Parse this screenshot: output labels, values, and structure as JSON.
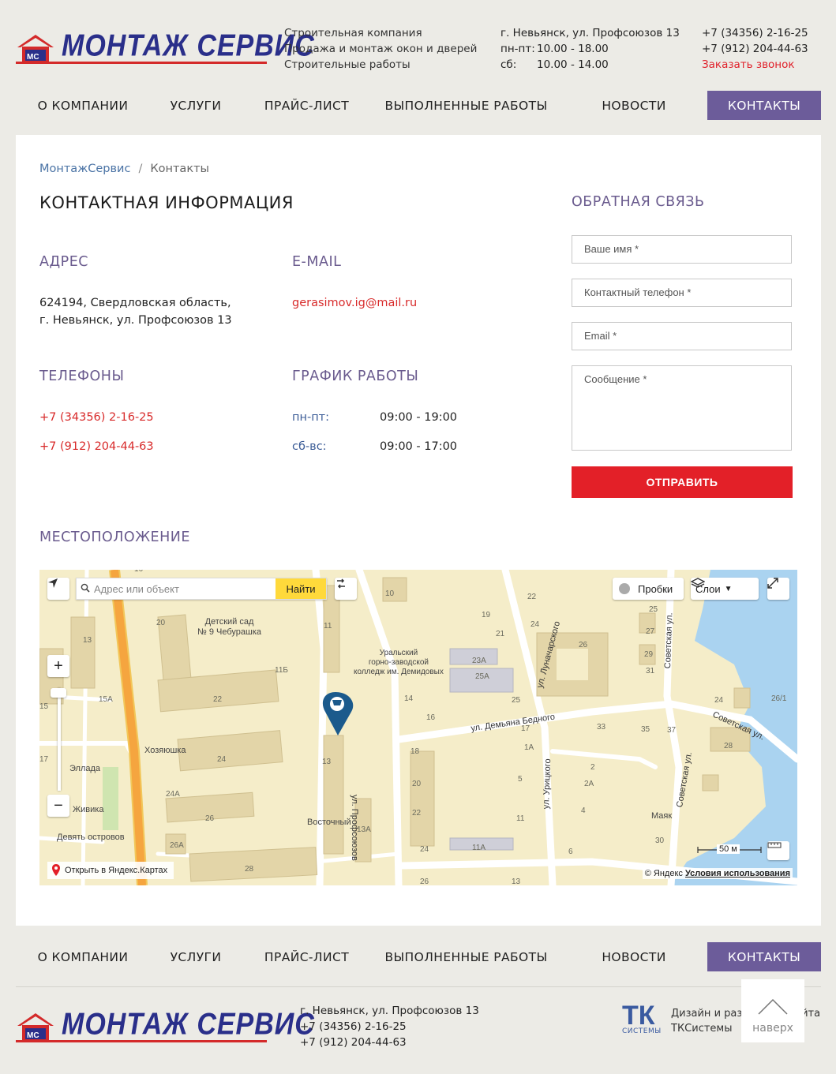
{
  "header": {
    "brand": "МОНТАЖ СЕРВИС",
    "badge": "МС",
    "desc": [
      "Строительная компания",
      "Продажа и монтаж окон и дверей",
      "Строительные работы"
    ],
    "address": "г. Невьянск, ул. Профсоюзов 13",
    "hours": [
      {
        "label": "пн-пт:",
        "value": "10.00 - 18.00"
      },
      {
        "label": "сб:",
        "value": "10.00 - 14.00"
      }
    ],
    "phones": [
      "+7 (34356) 2-16-25",
      "+7 (912) 204-44-63"
    ],
    "callback": "Заказать звонок"
  },
  "nav": {
    "items": [
      "О КОМПАНИИ",
      "УСЛУГИ",
      "ПРАЙС-ЛИСТ",
      "ВЫПОЛНЕННЫЕ РАБОТЫ",
      "НОВОСТИ",
      "КОНТАКТЫ"
    ]
  },
  "breadcrumb": {
    "home": "МонтажСервис",
    "sep": "/",
    "current": "Контакты"
  },
  "page_title": "КОНТАКТНАЯ ИНФОРМАЦИЯ",
  "contacts": {
    "address_h": "АДРЕС",
    "address": [
      "624194, Свердловская область,",
      "г. Невьянск, ул. Профсоюзов 13"
    ],
    "email_h": "E-MAIL",
    "email": "gerasimov.ig@mail.ru",
    "phones_h": "ТЕЛЕФОНЫ",
    "phones": [
      "+7 (34356) 2-16-25",
      "+7 (912) 204-44-63"
    ],
    "schedule_h": "ГРАФИК РАБОТЫ",
    "schedule": [
      {
        "label": "пн-пт:",
        "value": "09:00 - 19:00"
      },
      {
        "label": "сб-вс:",
        "value": "09:00 - 17:00"
      }
    ]
  },
  "form": {
    "title": "ОБРАТНАЯ СВЯЗЬ",
    "name_ph": "Ваше имя *",
    "phone_ph": "Контактный телефон *",
    "email_ph": "Email *",
    "message_ph": "Сообщение *",
    "submit": "ОТПРАВИТЬ"
  },
  "location_h": "МЕСТОПОЛОЖЕНИЕ",
  "map": {
    "search_ph": "Адрес или объект",
    "find": "Найти",
    "traffic": "Пробки",
    "layers": "Слои",
    "open": "Открыть в Яндекс.Картах",
    "copyright": "© Яндекс",
    "terms": "Условия использования",
    "scale": "50 м",
    "labels": {
      "kinder": [
        "Детский сад",
        "№ 9 Чебурашка"
      ],
      "college": [
        "Уральский",
        "горно-заводской",
        "колледж им. Демидовых"
      ],
      "st_profsoyuzov": "ул. Профсоюзов",
      "st_lunacharskogo": "ул. Луначарского",
      "st_demyana": "ул. Демьяна Бедного",
      "st_sovetskaya1": "Советская ул.",
      "st_sovetskaya2": "Советская ул.",
      "st_sovetskaya3": "Советская ул.",
      "st_uritskogo": "ул. Урицкого",
      "hozyayushka": "Хозяюшка",
      "ellada": "Эллада",
      "zhivika": "Живика",
      "devyat": "Девять островов",
      "vostochny": "Восточный",
      "mayak": "Маяк"
    }
  },
  "footer": {
    "address": "г. Невьянск, ул. Профсоюзов 13",
    "phones": [
      "+7 (34356) 2-16-25",
      "+7 (912) 204-44-63"
    ],
    "tk_mark": "ТК",
    "tk_sub": "СИСТЕМЫ",
    "tk_text": "Дизайн и разработка сайта",
    "tk_link": "ТКСистемы",
    "totop": "наверх"
  },
  "colors": {
    "accent": "#6c5c9a",
    "red": "#e32028",
    "brand_blue": "#2a2f8a"
  }
}
